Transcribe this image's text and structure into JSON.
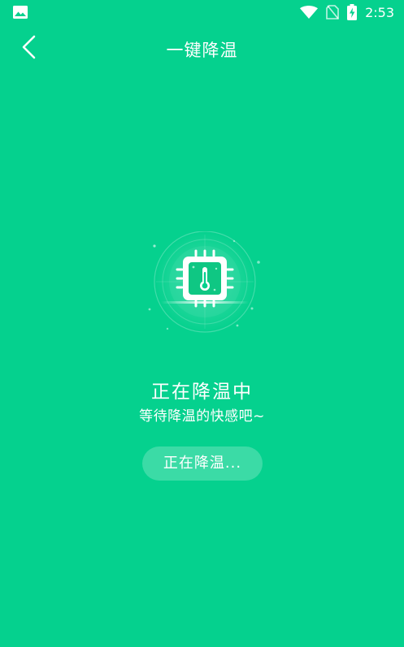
{
  "status_bar": {
    "left_icon": "image-notification-icon",
    "icons": [
      "wifi-icon",
      "no-sim-icon",
      "battery-charging-icon"
    ],
    "time": "2:53"
  },
  "header": {
    "back_icon": "chevron-left-icon",
    "title": "一键降温"
  },
  "main": {
    "graphic_icon": "cpu-thermometer-icon",
    "status_title": "正在降温中",
    "status_subtitle": "等待降温的快感吧~",
    "progress_button_label": "正在降温..."
  },
  "colors": {
    "background": "#05D18E",
    "text": "#FFFFFF",
    "accent_dark": "#04B87A"
  }
}
